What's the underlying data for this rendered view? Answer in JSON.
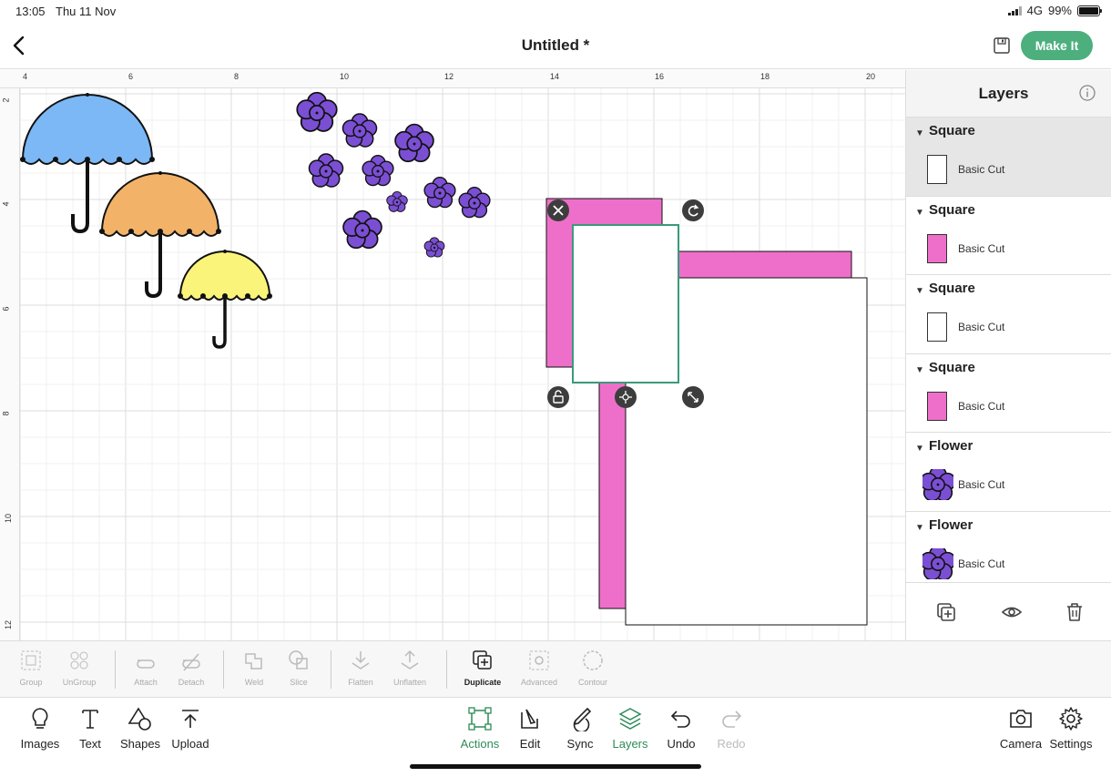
{
  "status_bar": {
    "time": "13:05",
    "date": "Thu 11 Nov",
    "network": "4G",
    "battery": "99%"
  },
  "header": {
    "title": "Untitled *",
    "make_it_label": "Make It",
    "accent_color": "#4caf7d"
  },
  "canvas": {
    "ruler_top": [
      "4",
      "6",
      "8",
      "10",
      "12",
      "14",
      "16",
      "18",
      "20"
    ],
    "ruler_left": [
      "2",
      "4",
      "6",
      "8",
      "10",
      "12"
    ],
    "colors": {
      "umbrella_blue": "#7bb8f5",
      "umbrella_orange": "#f2b368",
      "umbrella_yellow": "#fbf47a",
      "flower": "#7b4fd3",
      "square_pink": "#ee6fc9",
      "selection": "#3a9a7a"
    }
  },
  "layers_panel": {
    "title": "Layers",
    "groups": [
      {
        "name": "Square",
        "layer": "Basic Cut",
        "thumb": "white",
        "selected": true
      },
      {
        "name": "Square",
        "layer": "Basic Cut",
        "thumb": "pink",
        "selected": false
      },
      {
        "name": "Square",
        "layer": "Basic Cut",
        "thumb": "white",
        "selected": false
      },
      {
        "name": "Square",
        "layer": "Basic Cut",
        "thumb": "pink",
        "selected": false
      },
      {
        "name": "Flower",
        "layer": "Basic Cut",
        "thumb": "flower",
        "selected": false
      },
      {
        "name": "Flower",
        "layer": "Basic Cut",
        "thumb": "flower",
        "selected": false
      }
    ],
    "footer_icons": [
      "duplicate-icon",
      "eye-icon",
      "trash-icon"
    ]
  },
  "edit_bar": {
    "group": "Group",
    "ungroup": "UnGroup",
    "attach": "Attach",
    "detach": "Detach",
    "weld": "Weld",
    "slice": "Slice",
    "flatten": "Flatten",
    "unflatten": "Unflatten",
    "duplicate": "Duplicate",
    "advanced": "Advanced",
    "contour": "Contour"
  },
  "bottom_bar": {
    "images": "Images",
    "text": "Text",
    "shapes": "Shapes",
    "upload": "Upload",
    "actions": "Actions",
    "edit": "Edit",
    "sync": "Sync",
    "layers": "Layers",
    "undo": "Undo",
    "redo": "Redo",
    "camera": "Camera",
    "settings": "Settings"
  }
}
